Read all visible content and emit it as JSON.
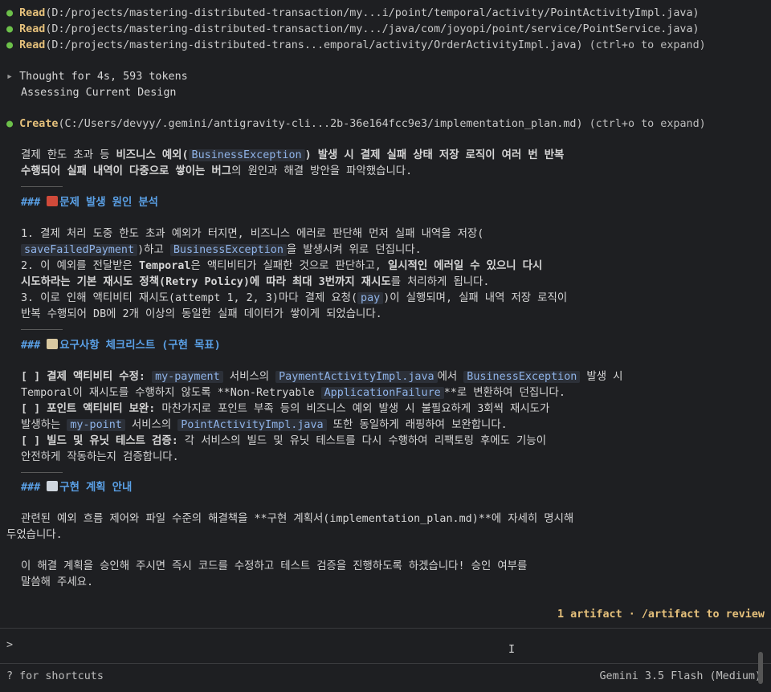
{
  "read_lines": [
    {
      "keyword": "Read",
      "path": "(D:/projects/mastering-distributed-transaction/my...i/point/temporal/activity/PointActivityImpl.java)",
      "suffix": ""
    },
    {
      "keyword": "Read",
      "path": "(D:/projects/mastering-distributed-transaction/my.../java/com/joyopi/point/service/PointService.java)",
      "suffix": ""
    },
    {
      "keyword": "Read",
      "path": "(D:/projects/mastering-distributed-trans...emporal/activity/OrderActivityImpl.java)",
      "suffix": " (ctrl+o to expand)"
    }
  ],
  "thought": {
    "arrow": "▸",
    "title": "Thought for 4s, 593 tokens",
    "subtitle": "Assessing Current Design"
  },
  "create_line": {
    "keyword": "Create",
    "path": "(C:/Users/devyy/.gemini/antigravity-cli...2b-36e164fcc9e3/implementation_plan.md)",
    "suffix": " (ctrl+o to expand)"
  },
  "intro": {
    "l1_a": "결제 한도 초과 등 ",
    "l1_b": "비즈니스 예외(",
    "l1_code": "BusinessException",
    "l1_c": ") 발생 시 결제 실패 상태 저장 로직이 여러 번 반복",
    "l2_a": "수행되어 실패 내역이 다중으로 쌓이는 버그",
    "l2_b": "의 원인과 해결 방안을 파악했습니다."
  },
  "section1": {
    "heading": "### ",
    "title": "문제 발생 원인 분석",
    "p1_a": "1. 결제 처리 도중 한도 초과 예외가 터지면, 비즈니스 에러로 판단해 먼저 실패 내역을 저장(",
    "p1_code1": "saveFailedPayment",
    "p1_b": ")하고 ",
    "p1_code2": "BusinessException",
    "p1_c": "을 발생시켜 위로 던집니다.",
    "p2_a": "2. 이 예외를 전달받은 ",
    "p2_b": "Temporal",
    "p2_c": "은 액티비티가 실패한 것으로 판단하고, ",
    "p2_d": "일시적인 에러일 수 있으니 다시",
    "p2_e": "시도하라는 기본 재시도 정책(Retry Policy)에 따라 최대 3번까지 재시도",
    "p2_f": "를 처리하게 됩니다.",
    "p3_a": "3. 이로 인해 액티비티 재시도(attempt 1, 2, 3)마다 결제 요청(",
    "p3_code": "pay",
    "p3_b": ")이 실행되며, 실패 내역 저장 로직이",
    "p3_c": "반복 수행되어 DB에 2개 이상의 동일한 실패 데이터가 쌓이게 되었습니다."
  },
  "section2": {
    "heading": "### ",
    "title": "요구사항 체크리스트 (구현 목표)",
    "c1_a": "[ ] 결제 액티비티 수정:",
    "c1_code1": "my-payment",
    "c1_b": " 서비스의 ",
    "c1_code2": "PaymentActivityImpl.java",
    "c1_c": "에서 ",
    "c1_code3": "BusinessException",
    "c1_d": " 발생 시",
    "c1_e": "Temporal이 재시도를 수행하지 않도록 **Non-Retryable ",
    "c1_code4": "ApplicationFailure",
    "c1_f": "**로 변환하여 던집니다.",
    "c2_a": "[ ] 포인트 액티비티 보완:",
    "c2_b": " 마찬가지로 포인트 부족 등의 비즈니스 예외 발생 시 불필요하게 3회씩 재시도가",
    "c2_c": "발생하는 ",
    "c2_code1": "my-point",
    "c2_d": " 서비스의 ",
    "c2_code2": "PointActivityImpl.java",
    "c2_e": " 또한 동일하게 래핑하여 보완합니다.",
    "c3_a": "[ ] 빌드 및 유닛 테스트 검증:",
    "c3_b": " 각 서비스의 빌드 및 유닛 테스트를 다시 수행하여 리팩토링 후에도 기능이",
    "c3_c": "안전하게 작동하는지 검증합니다."
  },
  "section3": {
    "heading": "### ",
    "title": "구현 계획 안내",
    "p1": "관련된 예외 흐름 제어와 파일 수준의 해결책을 **구현 계획서(implementation_plan.md)**에 자세히 명시해",
    "p1b": "두었습니다.",
    "p2": "이 해결 계획을 승인해 주시면 즉시 코드를 수정하고 테스트 검증을 진행하도록 하겠습니다! 승인 여부를",
    "p2b": "말씀해 주세요."
  },
  "artifact_bar": "1 artifact · /artifact to review",
  "prompt_symbol": ">",
  "footer": {
    "left": "? for shortcuts",
    "right": "Gemini 3.5 Flash (Medium)"
  },
  "colors": {
    "background": "#1e1f22",
    "accent_yellow": "#e5c07b",
    "heading_blue": "#5aa0e6",
    "code_blue": "#8fb3e8",
    "dot_green": "#6cc04a"
  }
}
